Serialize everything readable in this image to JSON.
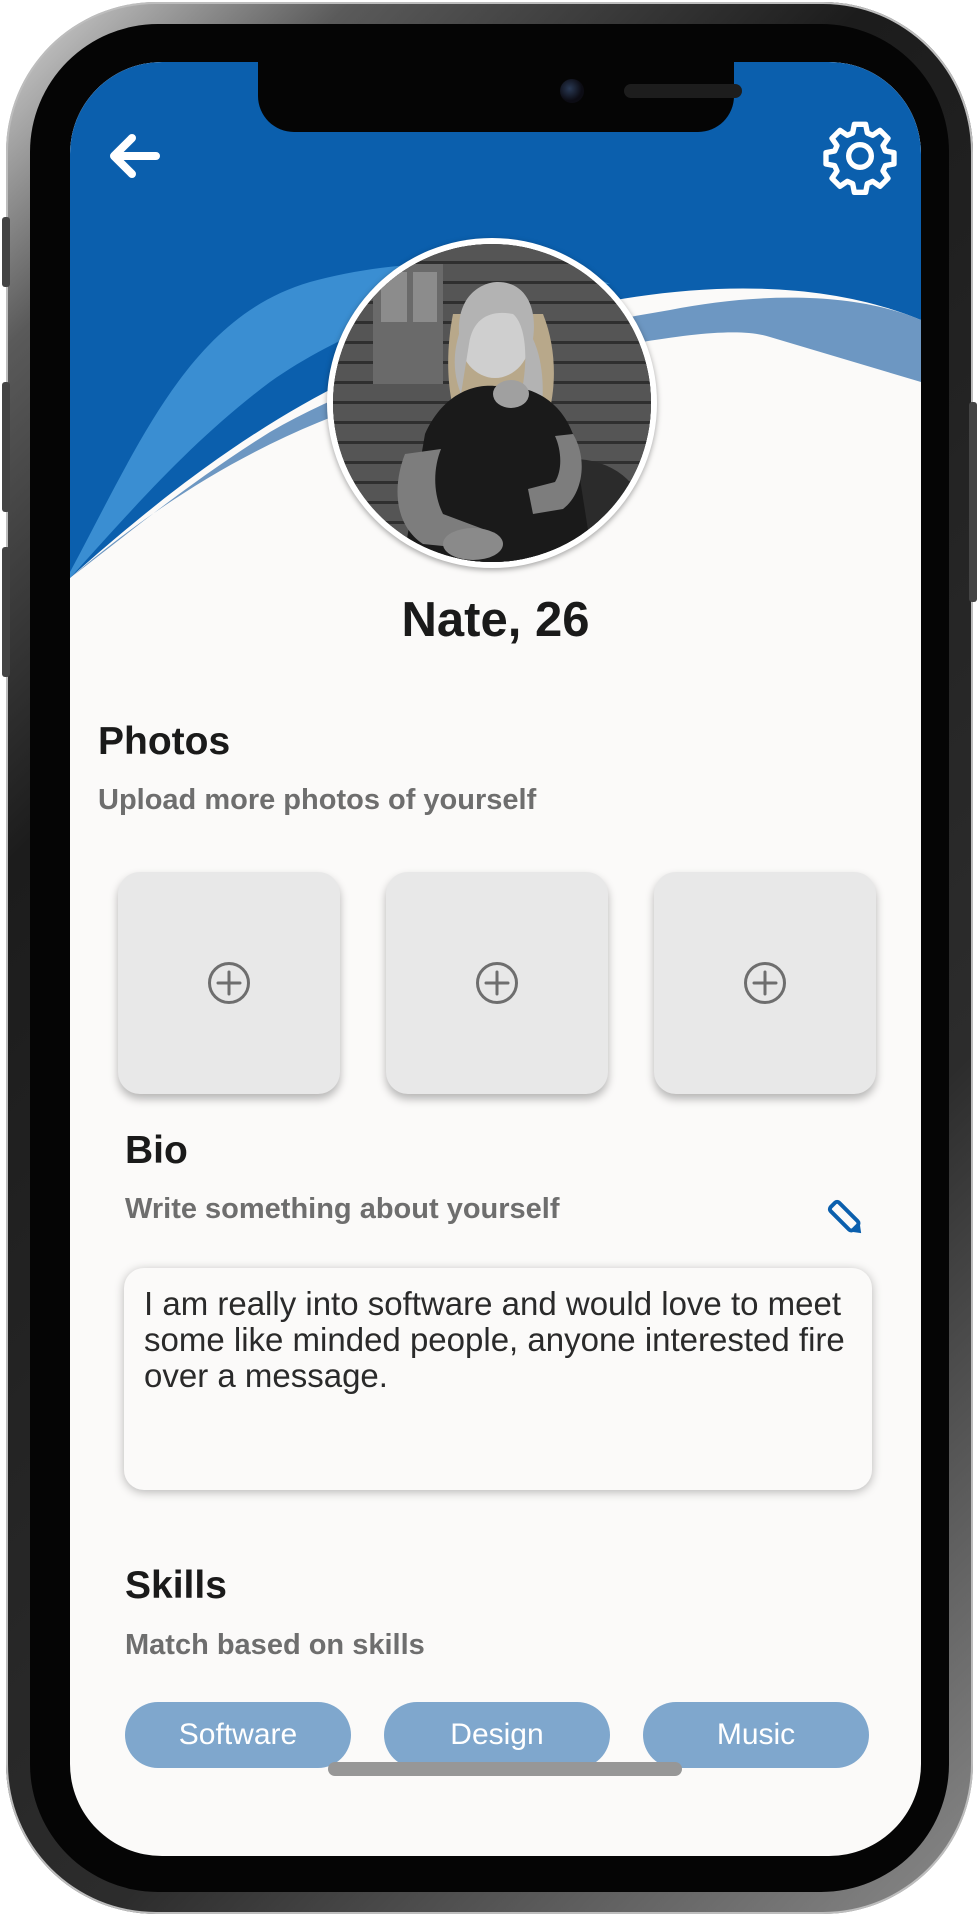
{
  "header": {
    "back_icon": "arrow-left-icon",
    "settings_icon": "gear-icon",
    "accent_color": "#0b5fad",
    "wave_light_color": "#3a8ed2"
  },
  "profile": {
    "name_age": "Nate, 26",
    "photo_description_icon": "avatar-photo"
  },
  "photos": {
    "title": "Photos",
    "subtitle": "Upload more photos of yourself",
    "slots": [
      {
        "icon": "plus-circle-icon"
      },
      {
        "icon": "plus-circle-icon"
      },
      {
        "icon": "plus-circle-icon"
      }
    ]
  },
  "bio": {
    "title": "Bio",
    "subtitle": "Write something about yourself",
    "edit_icon": "pencil-icon",
    "text": "I am really into software and would love to meet some like minded people, anyone interested fire over a message."
  },
  "skills": {
    "title": "Skills",
    "subtitle": "Match based on skills",
    "items": [
      "Software",
      "Design",
      "Music"
    ],
    "pill_color": "#7fa7cd"
  }
}
